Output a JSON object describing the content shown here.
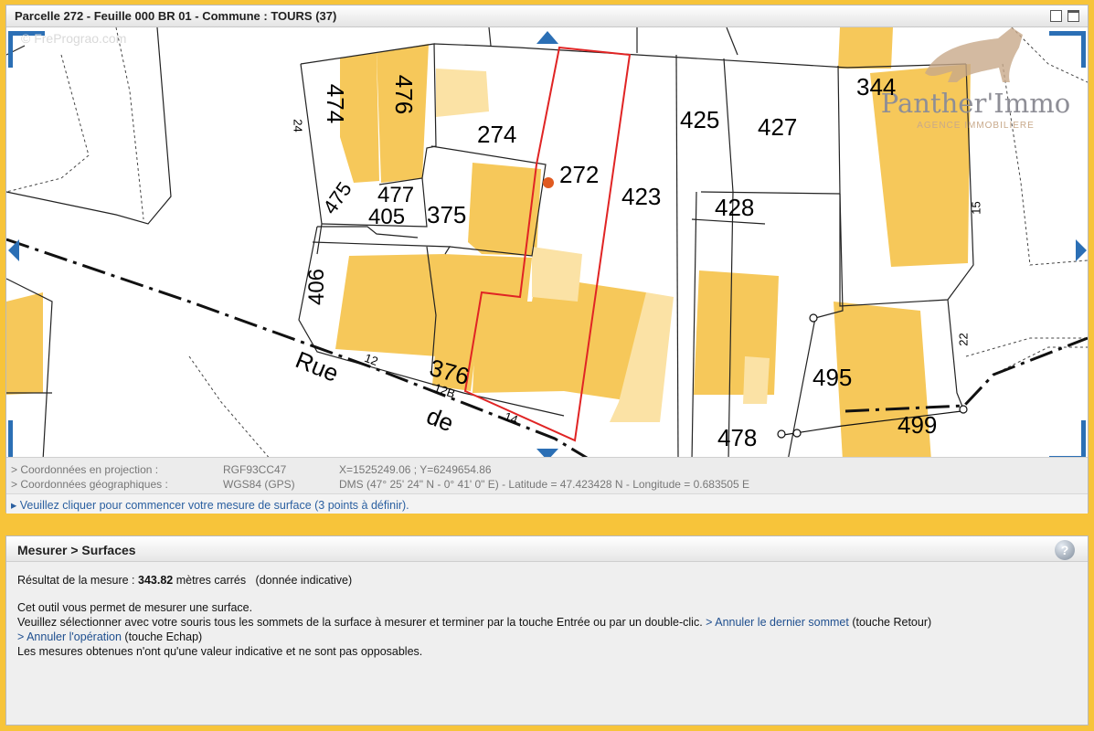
{
  "map_panel": {
    "title": "Parcelle 272 - Feuille 000 BR 01 - Commune : TOURS (37)",
    "watermark": "© FrePrograo.com",
    "brand": {
      "name": "Panther'Immo",
      "tagline": "AGENCE IMMOBILIERE"
    },
    "parcels": [
      "474",
      "476",
      "274",
      "272",
      "423",
      "425",
      "427",
      "344",
      "475",
      "477",
      "405",
      "375",
      "428",
      "406",
      "376",
      "495",
      "478",
      "499"
    ],
    "small_labels": [
      "24",
      "15",
      "22",
      "12",
      "12B",
      "14"
    ],
    "street": [
      "Rue",
      "de"
    ],
    "coordinates": [
      {
        "label": "> Coordonnées en projection :",
        "system": "RGF93CC47",
        "value": "X=1525249.06 ; Y=6249654.86"
      },
      {
        "label": "> Coordonnées géographiques :",
        "system": "WGS84 (GPS)",
        "value": "DMS (47° 25' 24\" N - 0° 41' 0\" E) - Latitude = 47.423428 N - Longitude = 0.683505 E"
      }
    ],
    "hint": "▸ Veuillez cliquer pour commencer votre mesure de surface (3 points à définir)."
  },
  "measure_panel": {
    "title": "Mesurer > Surfaces",
    "help_icon": "?",
    "result_prefix": "Résultat de la mesure : ",
    "result_value": "343.82",
    "result_suffix": " mètres carrés   (donnée indicative)",
    "desc1": "Cet outil vous permet de mesurer une surface.",
    "desc2": "Veuillez sélectionner avec votre souris tous les sommets de la surface à mesurer et terminer par la touche Entrée ou par un double-clic. ",
    "link_undo_last": "> Annuler le dernier sommet",
    "undo_last_key": " (touche Retour)",
    "link_cancel": "> Annuler l'opération",
    "cancel_key": " (touche Echap)",
    "desc3": "Les mesures obtenues n'ont qu'une valeur indicative et ne sont pas opposables."
  }
}
